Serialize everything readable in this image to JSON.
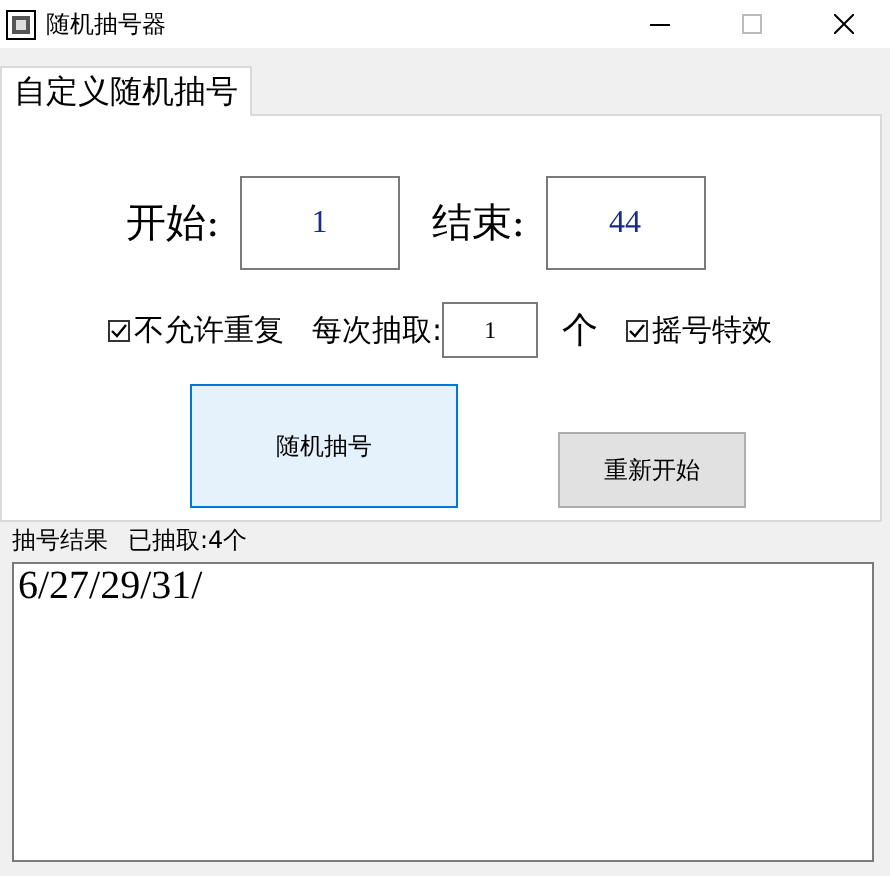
{
  "window": {
    "title": "随机抽号器"
  },
  "tabs": [
    {
      "label": "自定义随机抽号",
      "selected": true
    }
  ],
  "range": {
    "start_label": "开始:",
    "start_value": "1",
    "end_label": "结束:",
    "end_value": "44"
  },
  "options": [
    {
      "kind": "checkbox",
      "label": "不允许重复",
      "checked": true
    },
    {
      "kind": "number",
      "label": "每次抽取:",
      "value": "1",
      "unit": "个"
    },
    {
      "kind": "checkbox",
      "label": "摇号特效",
      "checked": true
    }
  ],
  "buttons": [
    {
      "label": "随机抽号",
      "focused": true
    },
    {
      "label": "重新开始",
      "focused": false
    }
  ],
  "result": {
    "title": "抽号结果",
    "count": "已抽取:4个",
    "text": "6/27/29/31/"
  }
}
